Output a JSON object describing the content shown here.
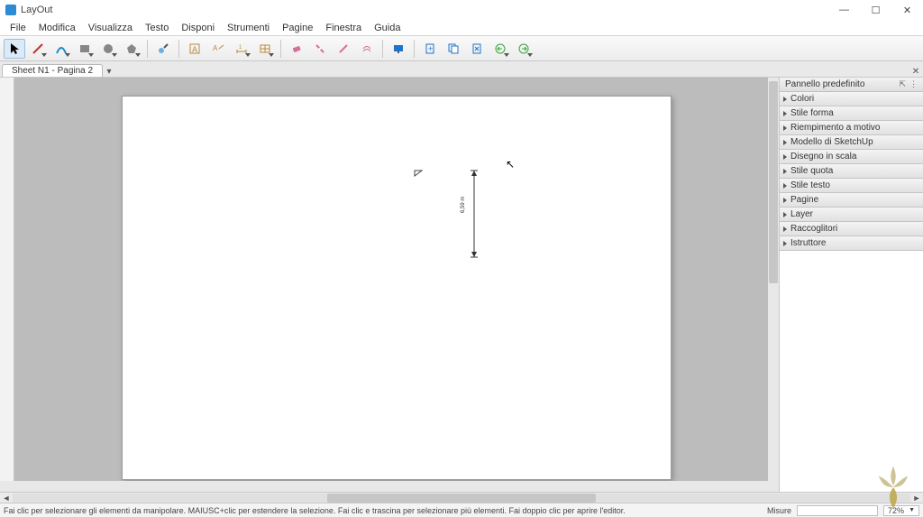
{
  "app": {
    "title": "LayOut"
  },
  "menubar": [
    "File",
    "Modifica",
    "Visualizza",
    "Testo",
    "Disponi",
    "Strumenti",
    "Pagine",
    "Finestra",
    "Guida"
  ],
  "toolbar_icons": [
    {
      "name": "select-tool",
      "color": "#000",
      "sel": true
    },
    {
      "name": "line-tool",
      "color": "#c0392b",
      "arrow": true
    },
    {
      "name": "arc-tool",
      "color": "#1e88c9",
      "arrow": true
    },
    {
      "name": "rectangle-tool",
      "color": "#6b6b6b",
      "arrow": true
    },
    {
      "name": "circle-tool",
      "color": "#6b6b6b",
      "arrow": true
    },
    {
      "name": "polygon-tool",
      "color": "#6b6b6b",
      "arrow": true
    },
    {
      "sep": true
    },
    {
      "name": "style-tool",
      "color": "#3a7fc4"
    },
    {
      "sep": true
    },
    {
      "name": "text-tool",
      "color": "#b78a3f"
    },
    {
      "name": "label-tool",
      "color": "#b78a3f"
    },
    {
      "name": "dimension-tool",
      "color": "#b78a3f",
      "arrow": true
    },
    {
      "name": "table-tool",
      "color": "#b78a3f",
      "arrow": true
    },
    {
      "sep": true
    },
    {
      "name": "eraser-tool",
      "color": "#d66f9a"
    },
    {
      "name": "split-tool",
      "color": "#d66f9a"
    },
    {
      "name": "join-tool",
      "color": "#d66f9a"
    },
    {
      "name": "offset-tool",
      "color": "#d66f9a"
    },
    {
      "sep": true
    },
    {
      "name": "present-tool",
      "color": "#1e74c9"
    },
    {
      "sep": true
    },
    {
      "name": "add-page",
      "color": "#1e74c9"
    },
    {
      "name": "duplicate-page",
      "color": "#1e74c9"
    },
    {
      "name": "delete-page",
      "color": "#1e74c9"
    },
    {
      "name": "prev-page",
      "color": "#3aa23a",
      "arrow": true
    },
    {
      "name": "next-page",
      "color": "#3aa23a",
      "arrow": true
    }
  ],
  "document_tab": "Sheet N1 - Pagina 2",
  "dimension_label": "6,59 m",
  "side_panel": {
    "title": "Pannello predefinito",
    "items": [
      "Colori",
      "Stile forma",
      "Riempimento a motivo",
      "Modello di SketchUp",
      "Disegno in scala",
      "Stile quota",
      "Stile testo",
      "Pagine",
      "Layer",
      "Raccoglitori",
      "Istruttore"
    ]
  },
  "statusbar": {
    "hint": "Fai clic per selezionare gli elementi da manipolare. MAIUSC+clic per estendere la selezione. Fai clic e trascina per selezionare più elementi. Fai doppio clic per aprire l'editor.",
    "label_misure": "Misure",
    "zoom": "72%"
  }
}
